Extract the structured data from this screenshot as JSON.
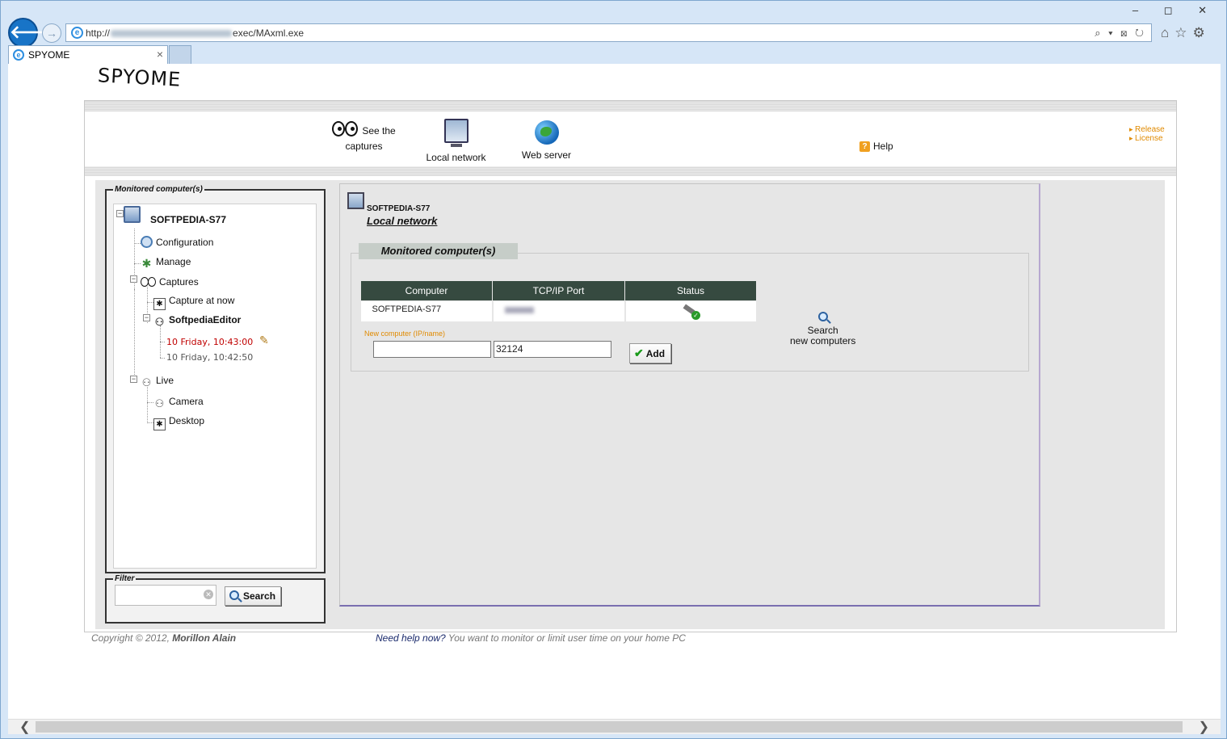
{
  "browser": {
    "url_prefix": "http://",
    "url_suffix": "exec/MAxml.exe",
    "tab_title": "SPYOME",
    "tab_close": "×",
    "back_glyph": "🡐",
    "fwd_glyph": "→",
    "addr_tools": "⌕ ▾ ⊠ ↻",
    "window_buttons": "‒ ◻ ✕",
    "toolbar_icons": "⌂☆⚙",
    "scroll_left": "❮",
    "scroll_right": "❯"
  },
  "app": {
    "logo": "SPYOME",
    "nav": [
      {
        "label": "See the captures",
        "label_line1": "See the",
        "label_line2": "captures",
        "icon": "eyes-icon"
      },
      {
        "label": "Local network",
        "icon": "network-computer-icon"
      },
      {
        "label": "Web server",
        "icon": "globe-icon"
      }
    ],
    "help": {
      "label": "Help",
      "icon_glyph": "?"
    },
    "right_links": [
      "Release",
      "License"
    ]
  },
  "sidebar": {
    "monitored_legend": "Monitored computer(s)",
    "tree": {
      "root": "SOFTPEDIA-S77",
      "configuration": "Configuration",
      "manage": "Manage",
      "captures": "Captures",
      "capture_now": "Capture at now",
      "user": "SoftpediaEditor",
      "capture_1": "10 Friday, 10:43:00",
      "capture_2": "10 Friday, 10:42:50",
      "live": "Live",
      "camera": "Camera",
      "desktop": "Desktop"
    },
    "filter_legend": "Filter",
    "filter_value": "",
    "search_button": "Search"
  },
  "main": {
    "computer_name": "SOFTPEDIA-S77",
    "page_subtitle": "Local network",
    "section_title": "Monitored computer(s)",
    "table": {
      "headers": [
        "Computer",
        "TCP/IP Port",
        "Status"
      ],
      "rows": [
        {
          "computer": "SOFTPEDIA-S77",
          "port": "",
          "status": "connected"
        }
      ]
    },
    "new_computer_label": "New computer (IP/name)",
    "new_computer_value": "",
    "port_value": "32124",
    "add_button": "Add",
    "search_new_line1": "Search",
    "search_new_line2": "new computers"
  },
  "footer": {
    "copyright_prefix": "Copyright © 2012, ",
    "author": "Morillon Alain",
    "need_help": "Need help now?",
    "tagline": " You want to monitor or limit user time on your home PC"
  }
}
